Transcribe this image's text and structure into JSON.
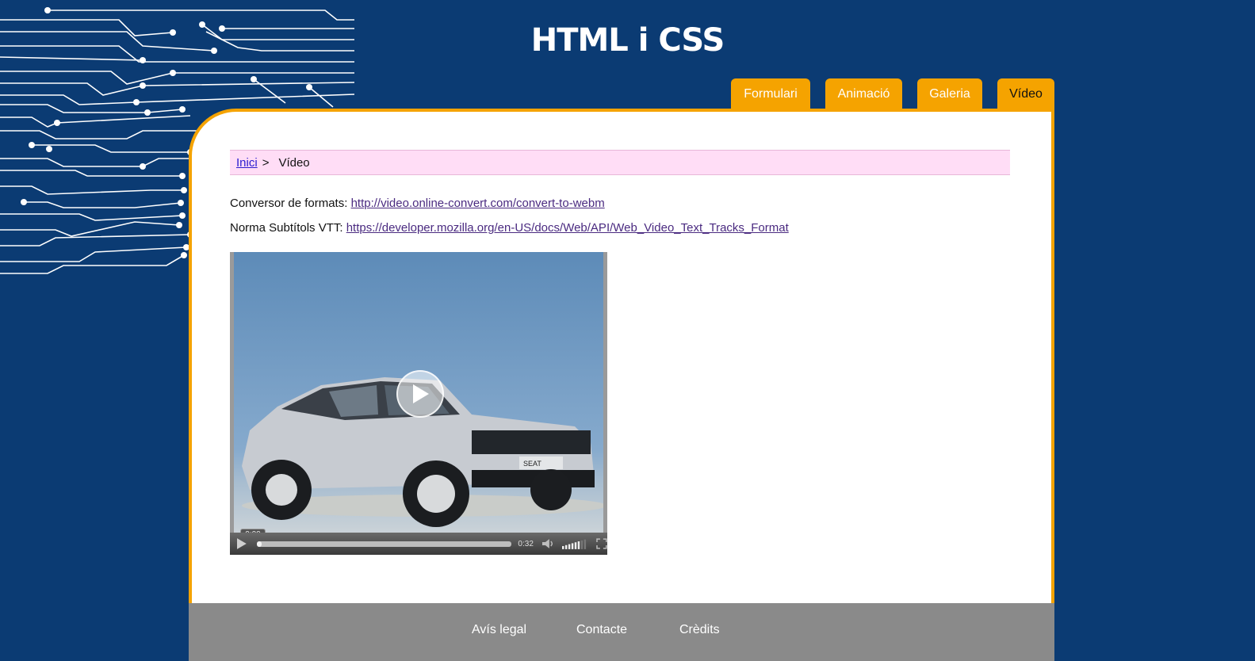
{
  "header": {
    "title": "HTML i CSS"
  },
  "nav": {
    "tabs": [
      {
        "label": "Formulari"
      },
      {
        "label": "Animació"
      },
      {
        "label": "Galeria"
      },
      {
        "label": "Vídeo"
      }
    ]
  },
  "breadcrumb": {
    "home": "Inici",
    "separator": ">",
    "current": "Vídeo"
  },
  "content": {
    "line1_label": "Conversor de formats:",
    "line1_link": "http://video.online-convert.com/convert-to-webm",
    "line2_label": "Norma Subtítols VTT:",
    "line2_link": "https://developer.mozilla.org/en-US/docs/Web/API/Web_Video_Text_Tracks_Format"
  },
  "video": {
    "current_time": "0:00",
    "duration": "0:32",
    "progress": 0.02,
    "volume": 0.8,
    "plate_text": "SEAT"
  },
  "footer": {
    "links": [
      {
        "label": "Avís legal"
      },
      {
        "label": "Contacte"
      },
      {
        "label": "Crèdits"
      }
    ]
  },
  "colors": {
    "background": "#0b3b73",
    "accent": "#f5a300",
    "breadcrumb_bg": "#ffddf6",
    "footer_bg": "#8a8a8a"
  }
}
